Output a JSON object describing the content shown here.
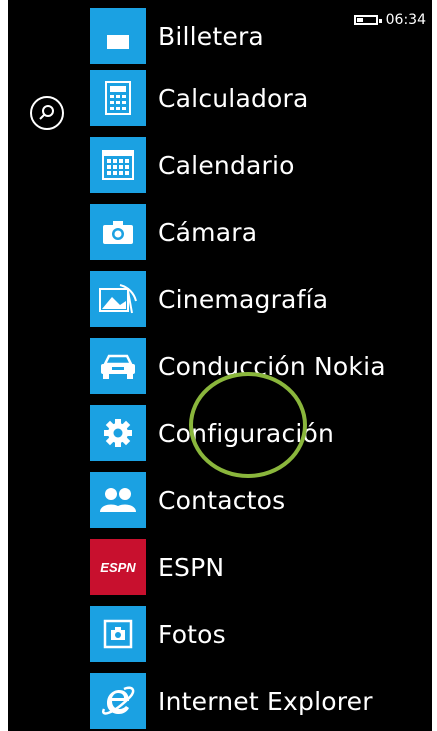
{
  "status": {
    "time": "06:34"
  },
  "apps": [
    {
      "label": "Billetera",
      "icon": "wallet-icon"
    },
    {
      "label": "Calculadora",
      "icon": "calculator-icon"
    },
    {
      "label": "Calendario",
      "icon": "calendar-icon"
    },
    {
      "label": "Cámara",
      "icon": "camera-icon"
    },
    {
      "label": "Cinemagrafía",
      "icon": "cinemagraph-icon"
    },
    {
      "label": "Conducción Nokia",
      "icon": "car-icon"
    },
    {
      "label": "Configuración",
      "icon": "gear-icon"
    },
    {
      "label": "Contactos",
      "icon": "contacts-icon"
    },
    {
      "label": "ESPN",
      "icon": "espn-logo",
      "logo_text": "ESPN"
    },
    {
      "label": "Fotos",
      "icon": "photos-icon"
    },
    {
      "label": "Internet Explorer",
      "icon": "internet-explorer-icon"
    }
  ],
  "colors": {
    "tile": "#1ba1e2",
    "espn": "#c8102e",
    "highlight_ring": "#8ab63c"
  }
}
